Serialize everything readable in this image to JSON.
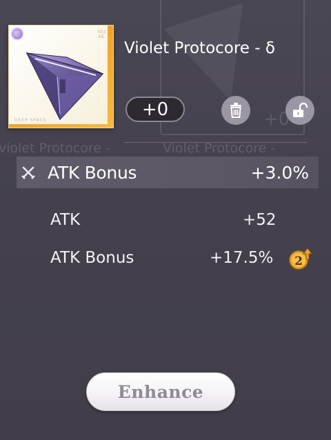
{
  "item": {
    "name": "Violet Protocore - δ",
    "card_code": "EE2XIE",
    "card_brand": "DEEP SPACE",
    "level": "+0"
  },
  "ghost": {
    "name_left": "violet Protocore -",
    "name_right": "Violet Protocore -",
    "plus": "+0"
  },
  "stats": {
    "main": {
      "label": "ATK Bonus",
      "value": "+3.0%",
      "icon": "crossed-swords-icon"
    },
    "sub": [
      {
        "label": "ATK",
        "value": "+52"
      },
      {
        "label": "ATK Bonus",
        "value": "+17.5%",
        "badge": "2"
      }
    ]
  },
  "actions": {
    "trash_icon": "trash-icon",
    "lock_icon": "unlock-icon",
    "enhance_label": "Enhance"
  },
  "colors": {
    "background": "#45424f",
    "card_accent": "#f0a32a",
    "badge_gold": "#e8a62c",
    "gem_purple": "#6b55a5"
  }
}
